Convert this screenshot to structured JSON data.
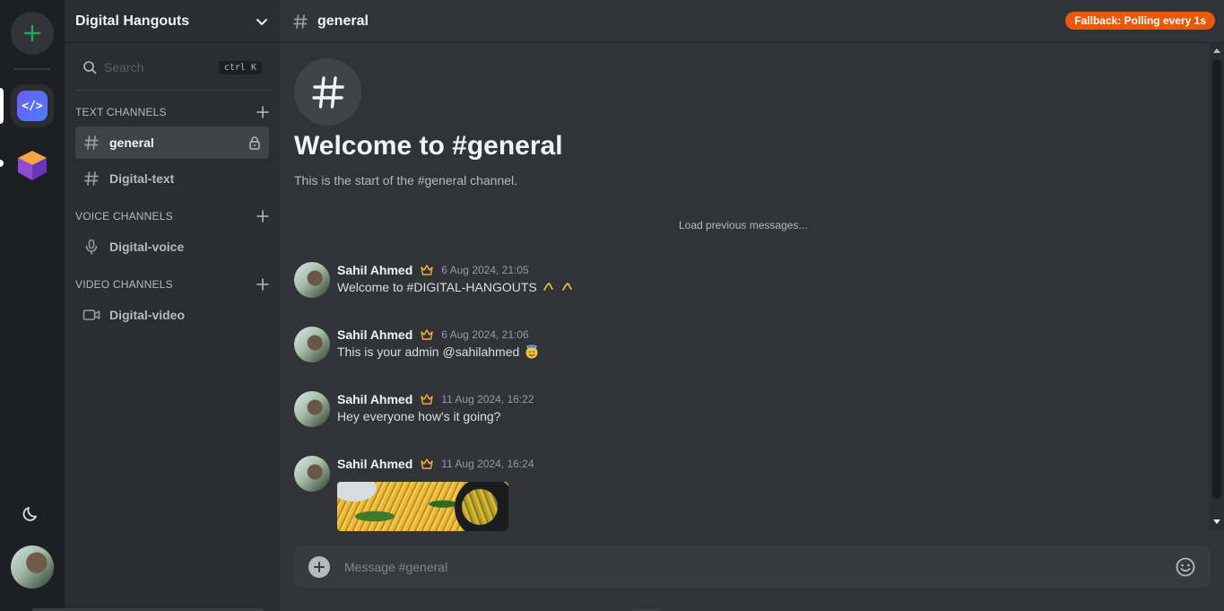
{
  "server": {
    "name": "Digital Hangouts"
  },
  "search": {
    "placeholder": "Search",
    "shortcut": "ctrl K"
  },
  "categories": {
    "text": "TEXT CHANNELS",
    "voice": "VOICE CHANNELS",
    "video": "VIDEO CHANNELS"
  },
  "channels": {
    "text": [
      {
        "label": "general",
        "active": true,
        "locked": true
      },
      {
        "label": "Digital-text"
      }
    ],
    "voice": [
      {
        "label": "Digital-voice"
      }
    ],
    "video": [
      {
        "label": "Digital-video"
      }
    ]
  },
  "topbar": {
    "channel": "general",
    "badge": "Fallback: Polling every 1s"
  },
  "hero": {
    "title": "Welcome to #general",
    "subtitle": "This is the start of the #general channel."
  },
  "load_previous": "Load previous messages...",
  "messages": [
    {
      "author": "Sahil Ahmed",
      "time": "6 Aug 2024, 21:05",
      "text": "Welcome to #DIGITAL-HANGOUTS",
      "emoji": "raised-hands"
    },
    {
      "author": "Sahil Ahmed",
      "time": "6 Aug 2024, 21:06",
      "text": "This is your admin @sahilahmed",
      "emoji": "smiling-face-with-halo"
    },
    {
      "author": "Sahil Ahmed",
      "time": "11 Aug 2024, 16:22",
      "text": "Hey everyone how's it going?"
    },
    {
      "author": "Sahil Ahmed",
      "time": "11 Aug 2024, 16:24",
      "attachment": "image"
    }
  ],
  "composer": {
    "placeholder": "Message #general"
  },
  "colors": {
    "accent_badge": "#e8590c",
    "add_server": "#23a55a",
    "crown": "#f0b232",
    "active_channel_bg": "#404249"
  }
}
